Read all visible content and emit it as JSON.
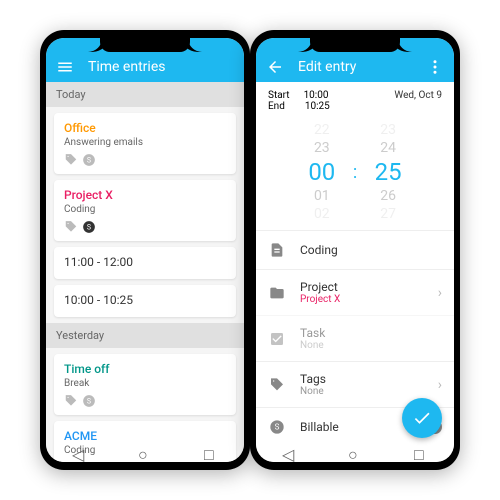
{
  "colors": {
    "accent": "#1eb8f0",
    "orange": "#ff9800",
    "pink": "#e91e63",
    "teal": "#009688",
    "blue": "#2196f3"
  },
  "left": {
    "title": "Time entries",
    "sections": [
      {
        "header": "Today",
        "entries": [
          {
            "title": "Office",
            "subtitle": "Answering emails",
            "color": "orange"
          },
          {
            "title": "Project X",
            "subtitle": "Coding",
            "color": "pink",
            "billable": true
          },
          {
            "title": "11:00 - 12:00"
          },
          {
            "title": "10:00 - 10:25"
          }
        ]
      },
      {
        "header": "Yesterday",
        "entries": [
          {
            "title": "Time off",
            "subtitle": "Break",
            "color": "teal"
          },
          {
            "title": "ACME",
            "subtitle": "Coding",
            "color": "blue"
          }
        ]
      }
    ]
  },
  "right": {
    "title": "Edit entry",
    "start_label": "Start",
    "start_time": "10:00",
    "end_label": "End",
    "end_time": "10:25",
    "date": "Wed, Oct 9",
    "picker": {
      "hours": [
        "22",
        "23",
        "00",
        "01",
        "02"
      ],
      "minutes": [
        "23",
        "24",
        "25",
        "26",
        "27"
      ]
    },
    "rows": {
      "description": "Coding",
      "project_label": "Project",
      "project_value": "Project X",
      "task_label": "Task",
      "task_value": "None",
      "tags_label": "Tags",
      "tags_value": "None",
      "billable_label": "Billable"
    }
  }
}
